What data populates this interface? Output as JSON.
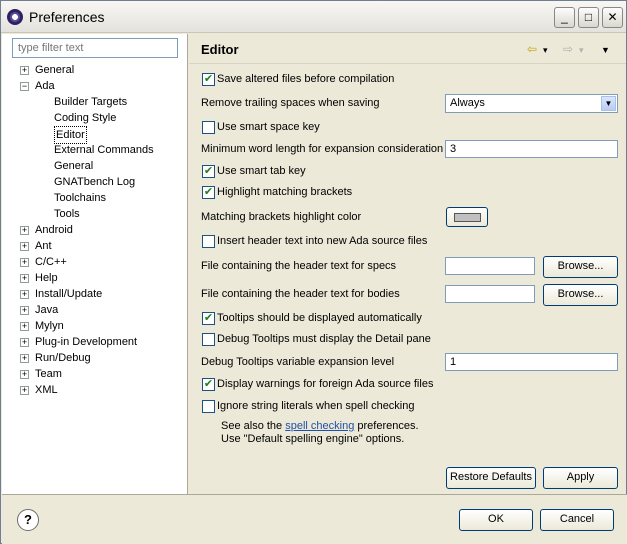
{
  "window": {
    "title": "Preferences",
    "minimize": "_",
    "maximize": "□",
    "close": "✕"
  },
  "filter": {
    "placeholder": "type filter text"
  },
  "tree": [
    {
      "label": "General",
      "indent": 0,
      "expander": "+"
    },
    {
      "label": "Ada",
      "indent": 0,
      "expander": "−"
    },
    {
      "label": "Builder Targets",
      "indent": 1
    },
    {
      "label": "Coding Style",
      "indent": 1
    },
    {
      "label": "Editor",
      "indent": 1,
      "selected": true
    },
    {
      "label": "External Commands",
      "indent": 1
    },
    {
      "label": "General",
      "indent": 1
    },
    {
      "label": "GNATbench Log",
      "indent": 1
    },
    {
      "label": "Toolchains",
      "indent": 1
    },
    {
      "label": "Tools",
      "indent": 1
    },
    {
      "label": "Android",
      "indent": 0,
      "expander": "+"
    },
    {
      "label": "Ant",
      "indent": 0,
      "expander": "+"
    },
    {
      "label": "C/C++",
      "indent": 0,
      "expander": "+"
    },
    {
      "label": "Help",
      "indent": 0,
      "expander": "+"
    },
    {
      "label": "Install/Update",
      "indent": 0,
      "expander": "+"
    },
    {
      "label": "Java",
      "indent": 0,
      "expander": "+"
    },
    {
      "label": "Mylyn",
      "indent": 0,
      "expander": "+"
    },
    {
      "label": "Plug-in Development",
      "indent": 0,
      "expander": "+"
    },
    {
      "label": "Run/Debug",
      "indent": 0,
      "expander": "+"
    },
    {
      "label": "Team",
      "indent": 0,
      "expander": "+"
    },
    {
      "label": "XML",
      "indent": 0,
      "expander": "+"
    }
  ],
  "editor": {
    "title": "Editor",
    "back_icon": "⇦",
    "forward_icon": "⇨",
    "dropdown_icon": "▾",
    "menu_icon": "▼",
    "save_altered": "Save altered files before compilation",
    "remove_trailing": "Remove trailing spaces when saving",
    "remove_trailing_value": "Always",
    "smart_space": "Use smart space key",
    "min_word_length": "Minimum word length for expansion consideration",
    "min_word_length_value": "3",
    "smart_tab": "Use smart tab key",
    "highlight_brackets": "Highlight matching brackets",
    "bracket_color": "Matching brackets highlight color",
    "insert_header": "Insert header text into new Ada source files",
    "header_specs": "File containing the header text for specs",
    "header_bodies": "File containing the header text for bodies",
    "browse": "Browse...",
    "tooltips_auto": "Tooltips should be displayed automatically",
    "debug_tooltips_detail": "Debug Tooltips must display the Detail pane",
    "debug_tooltips_level": "Debug Tooltips variable expansion level",
    "debug_tooltips_level_value": "1",
    "display_warnings": "Display warnings for foreign Ada source files",
    "ignore_string_literals": "Ignore string literals when spell checking",
    "see_also_prefix": "See also the",
    "spell_checking_link": "spell checking",
    "see_also_suffix": "preferences.",
    "use_default": "Use \"Default spelling engine\" options.",
    "restore_defaults": "Restore Defaults",
    "apply": "Apply"
  },
  "checked": {
    "save_altered": true,
    "smart_space": false,
    "smart_tab": true,
    "highlight_brackets": true,
    "insert_header": false,
    "tooltips_auto": true,
    "debug_tooltips_detail": false,
    "display_warnings": true,
    "ignore_string_literals": false
  },
  "colors": {
    "bracket_highlight": "#c0c0c0"
  },
  "footer": {
    "help": "?",
    "ok": "OK",
    "cancel": "Cancel"
  },
  "check_glyph": "✔"
}
